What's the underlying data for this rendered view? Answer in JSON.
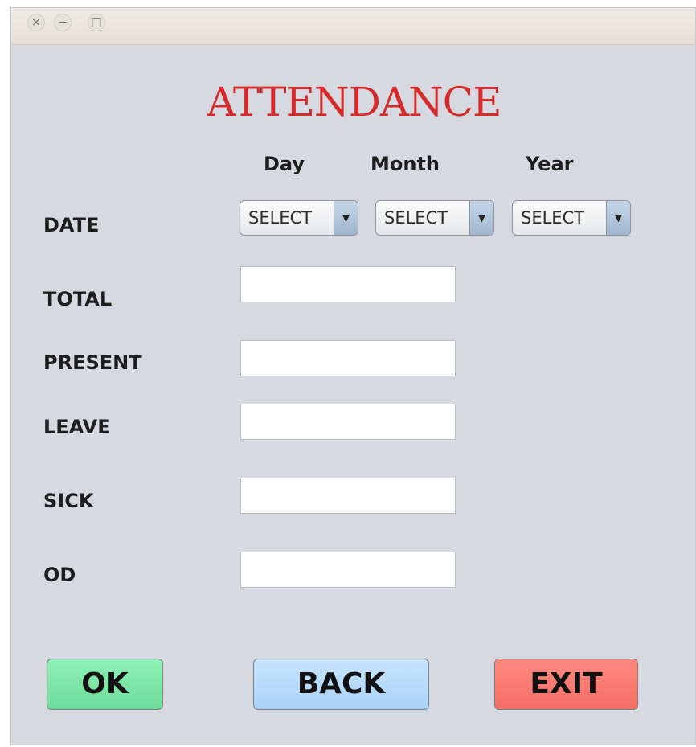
{
  "window": {
    "controls": {
      "close_icon": "×",
      "minimize_icon": "−",
      "maximize_icon": "□"
    }
  },
  "form": {
    "title": "ATTENDANCE",
    "columns": {
      "day": "Day",
      "month": "Month",
      "year": "Year"
    },
    "labels": {
      "date": "DATE",
      "total": "TOTAL",
      "present": "PRESENT",
      "leave": "LEAVE",
      "sick": "SICK",
      "od": "OD"
    },
    "selects": {
      "day": "SELECT",
      "month": "SELECT",
      "year": "SELECT"
    },
    "fields": {
      "total": "",
      "present": "",
      "leave": "",
      "sick": "",
      "od": ""
    },
    "buttons": {
      "ok": "OK",
      "back": "BACK",
      "exit": "EXIT"
    }
  },
  "colors": {
    "title": "#d62a2a",
    "ok_button": "#7de6a8",
    "back_button": "#b8dbfb",
    "exit_button": "#fa7d74",
    "window_background": "#d7d9e0"
  }
}
